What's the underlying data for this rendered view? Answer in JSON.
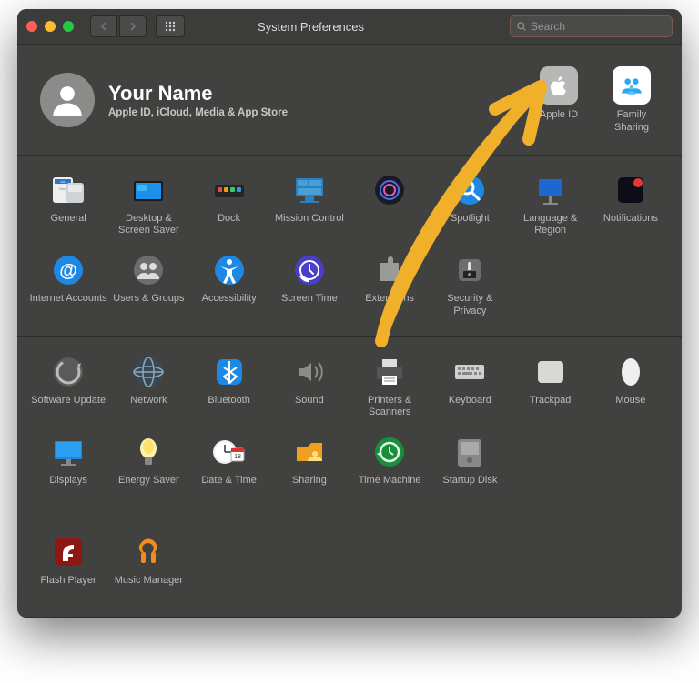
{
  "window_title": "System Preferences",
  "search": {
    "placeholder": "Search"
  },
  "user": {
    "name": "Your Name",
    "subtitle": "Apple ID, iCloud, Media & App Store"
  },
  "header_icons": {
    "apple_id": {
      "label": "Apple ID"
    },
    "family": {
      "label": "Family\nSharing"
    }
  },
  "grid": {
    "r1": [
      {
        "label": "General"
      },
      {
        "label": "Desktop & Screen Saver"
      },
      {
        "label": "Dock"
      },
      {
        "label": "Mission Control"
      },
      {
        "label": ""
      },
      {
        "label": "Spotlight"
      },
      {
        "label": "Language & Region"
      },
      {
        "label": "Notifications"
      }
    ],
    "r2": [
      {
        "label": "Internet Accounts"
      },
      {
        "label": "Users & Groups"
      },
      {
        "label": "Accessibility"
      },
      {
        "label": "Screen Time"
      },
      {
        "label": "Extensions"
      },
      {
        "label": "Security & Privacy"
      }
    ],
    "r3": [
      {
        "label": "Software Update"
      },
      {
        "label": "Network"
      },
      {
        "label": "Bluetooth"
      },
      {
        "label": "Sound"
      },
      {
        "label": "Printers & Scanners"
      },
      {
        "label": "Keyboard"
      },
      {
        "label": "Trackpad"
      },
      {
        "label": "Mouse"
      }
    ],
    "r4": [
      {
        "label": "Displays"
      },
      {
        "label": "Energy Saver"
      },
      {
        "label": "Date & Time"
      },
      {
        "label": "Sharing"
      },
      {
        "label": "Time Machine"
      },
      {
        "label": "Startup Disk"
      }
    ],
    "r5": [
      {
        "label": "Flash Player"
      },
      {
        "label": "Music Manager"
      }
    ]
  }
}
